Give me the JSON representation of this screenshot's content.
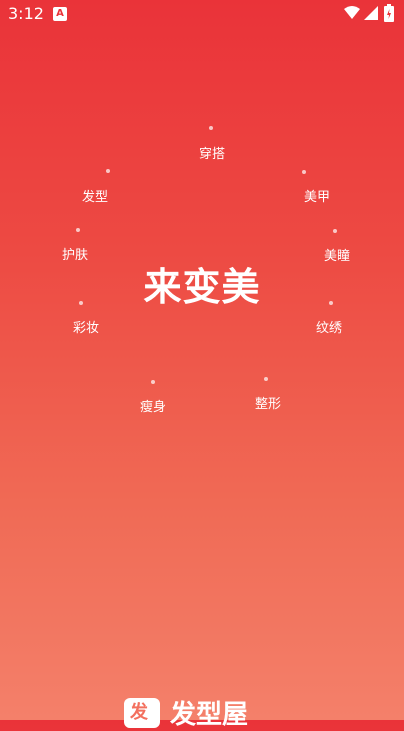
{
  "status_bar": {
    "time": "3:12",
    "badge": "A"
  },
  "center": {
    "title": "来变美"
  },
  "categories": [
    {
      "label": "穿搭"
    },
    {
      "label": "美甲"
    },
    {
      "label": "美瞳"
    },
    {
      "label": "纹绣"
    },
    {
      "label": "整形"
    },
    {
      "label": "瘦身"
    },
    {
      "label": "彩妆"
    },
    {
      "label": "护肤"
    },
    {
      "label": "发型"
    }
  ],
  "brand": {
    "logo_glyph": "发",
    "name": "发型屋"
  },
  "colors": {
    "gradient_top": "#ea3339",
    "gradient_bottom": "#f4806a"
  }
}
